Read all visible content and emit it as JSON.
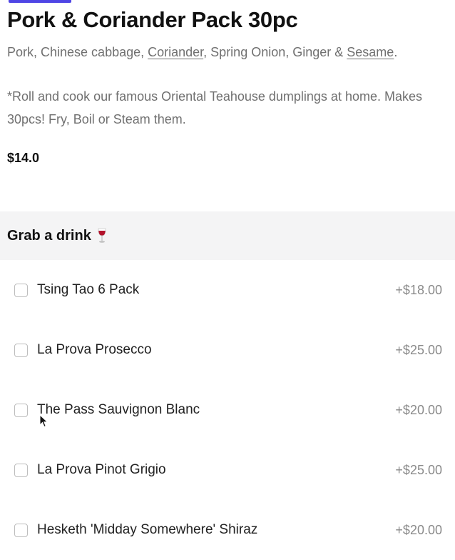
{
  "product": {
    "title": "Pork & Coriander Pack 30pc",
    "ingredients": {
      "part1": "Pork, Chinese cabbage, ",
      "link1": "Coriander",
      "part2": ", Spring Onion, Ginger & ",
      "link2": "Sesame",
      "part3": "."
    },
    "description": "*Roll and cook our famous Oriental Teahouse dumplings at home. Makes 30pcs! Fry, Boil or Steam them.",
    "price": "$14.0"
  },
  "drinks": {
    "title": "Grab a drink",
    "icon": "wine-glass-icon",
    "options": [
      {
        "label": "Tsing Tao 6 Pack",
        "price": "+$18.00",
        "checked": false
      },
      {
        "label": "La Prova Prosecco",
        "price": "+$25.00",
        "checked": false
      },
      {
        "label": "The Pass Sauvignon Blanc",
        "price": "+$20.00",
        "checked": false
      },
      {
        "label": "La Prova Pinot Grigio",
        "price": "+$25.00",
        "checked": false
      },
      {
        "label": "Hesketh 'Midday Somewhere' Shiraz",
        "price": "+$20.00",
        "checked": false
      }
    ]
  },
  "colors": {
    "accent": "#4f46e5",
    "section_bg": "#f4f4f5",
    "muted_text": "#707070"
  }
}
